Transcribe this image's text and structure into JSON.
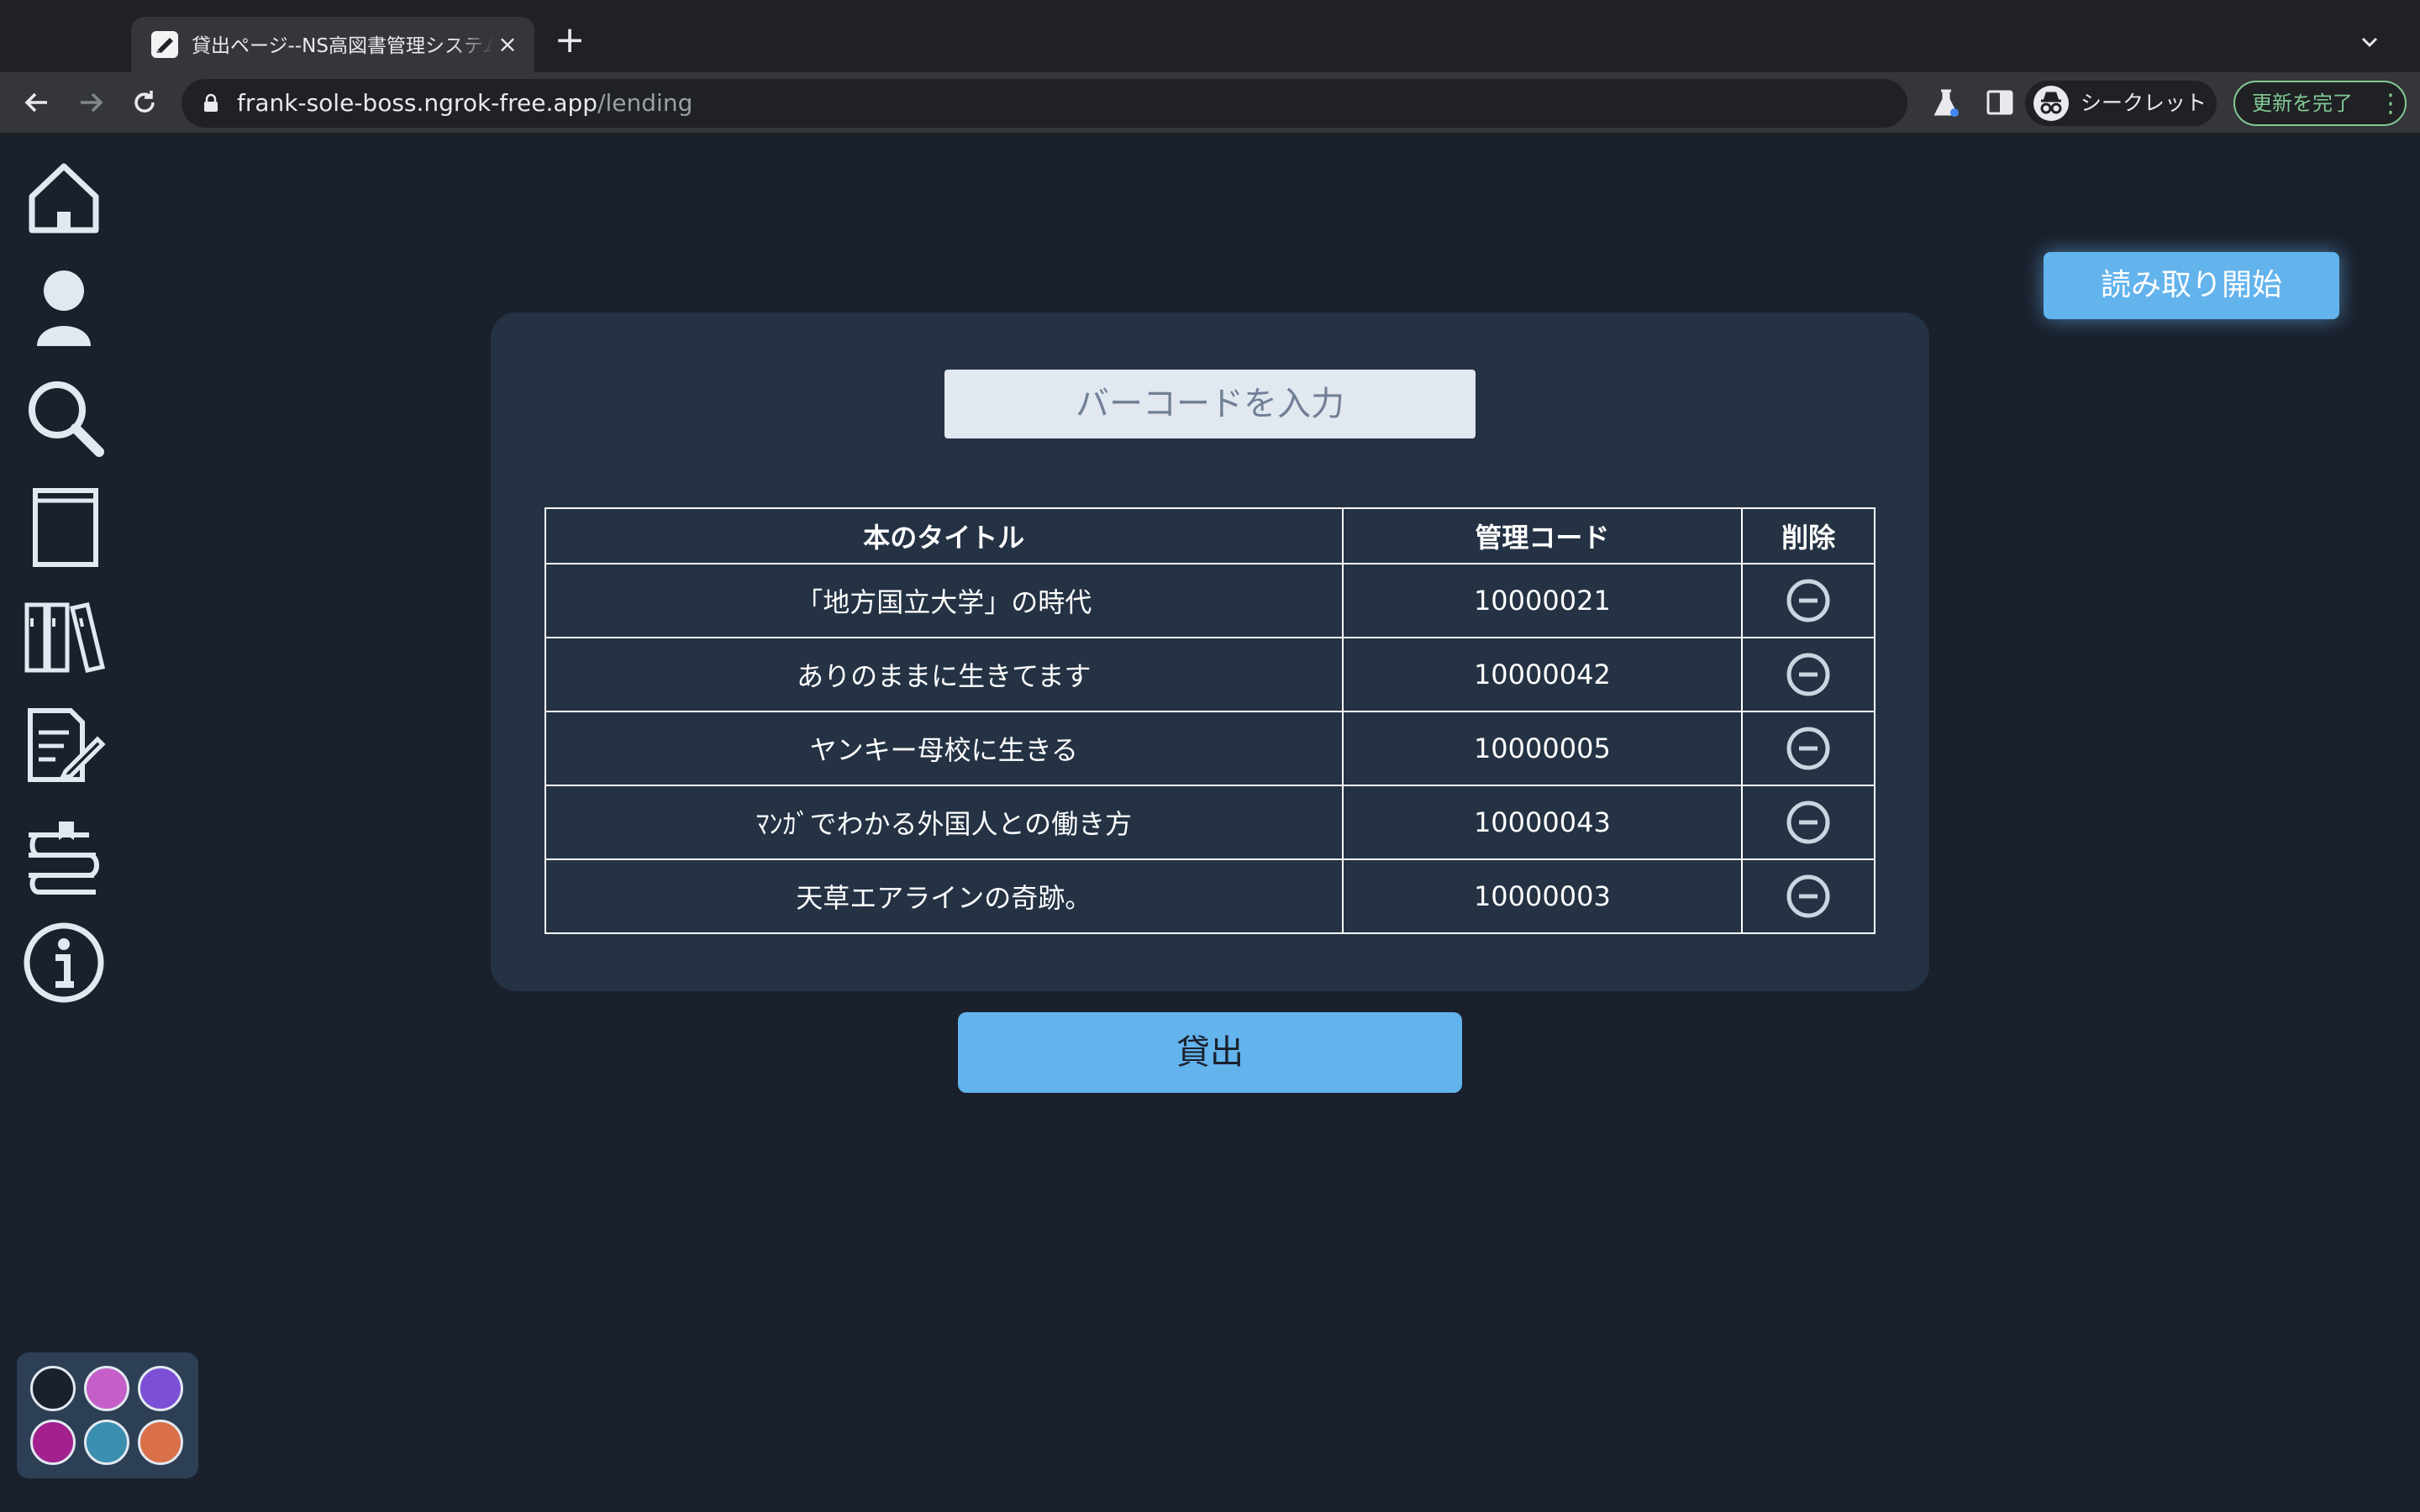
{
  "browser": {
    "tab_title": "貸出ページ--NS高図書管理システム",
    "url_host": "frank-sole-boss.ngrok-free.app",
    "url_path": "/lending",
    "incognito_label": "シークレット",
    "update_label": "更新を完了"
  },
  "sidebar": {
    "items": [
      {
        "icon": "home-icon"
      },
      {
        "icon": "user-icon"
      },
      {
        "icon": "search-icon"
      },
      {
        "icon": "book-icon"
      },
      {
        "icon": "library-icon"
      },
      {
        "icon": "edit-document-icon"
      },
      {
        "icon": "book-stack-icon"
      },
      {
        "icon": "info-icon"
      }
    ]
  },
  "palette": {
    "swatches": [
      "#1a202c",
      "#c45fc9",
      "#7b4fd6",
      "#a3208f",
      "#3a8fb0",
      "#d9704a"
    ]
  },
  "main": {
    "read_button": "読み取り開始",
    "barcode_placeholder": "バーコードを入力",
    "table": {
      "headers": [
        "本のタイトル",
        "管理コード",
        "削除"
      ],
      "rows": [
        {
          "title": "「地方国立大学」の時代",
          "code": "10000021"
        },
        {
          "title": "ありのままに生きてます",
          "code": "10000042"
        },
        {
          "title": "ヤンキー母校に生きる",
          "code": "10000005"
        },
        {
          "title": "ﾏﾝｶﾞでわかる外国人との働き方",
          "code": "10000043"
        },
        {
          "title": "天草エアラインの奇跡。",
          "code": "10000003"
        }
      ]
    },
    "lend_button": "貸出"
  }
}
